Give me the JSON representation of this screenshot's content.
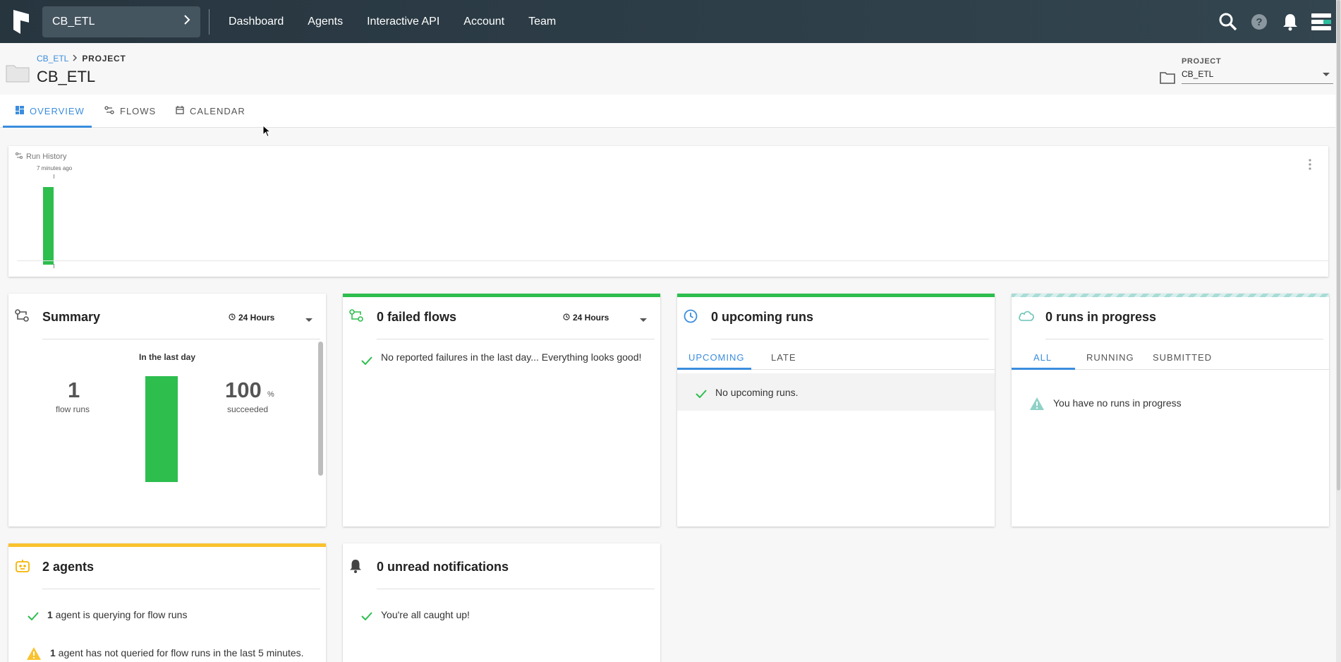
{
  "topbar": {
    "team_name": "CB_ETL",
    "nav": [
      "Dashboard",
      "Agents",
      "Interactive API",
      "Account",
      "Team"
    ],
    "icons": [
      "search-icon",
      "help-icon",
      "bell-icon",
      "menu-icon"
    ]
  },
  "header": {
    "breadcrumb_link": "CB_ETL",
    "breadcrumb_current": "PROJECT",
    "title": "CB_ETL",
    "project_picker_label": "PROJECT",
    "project_picker_value": "CB_ETL"
  },
  "tabs": [
    "OVERVIEW",
    "FLOWS",
    "CALENDAR"
  ],
  "run_history": {
    "title": "Run History",
    "label": "7 minutes ago",
    "runs": [
      {
        "state": "success",
        "color": "#2dbe4e"
      }
    ]
  },
  "summary": {
    "title": "Summary",
    "range": "24 Hours",
    "subtitle": "In the last day",
    "flow_runs": "1",
    "flow_runs_label": "flow runs",
    "succeeded_pct": "100",
    "pct_sign": "%",
    "succeeded_label": "succeeded"
  },
  "failed": {
    "title": "0 failed flows",
    "range": "24 Hours",
    "message": "No reported failures in the last day... Everything looks good!"
  },
  "upcoming": {
    "title": "0 upcoming runs",
    "tabs": [
      "UPCOMING",
      "LATE"
    ],
    "message": "No upcoming runs."
  },
  "in_progress": {
    "title": "0 runs in progress",
    "tabs": [
      "ALL",
      "RUNNING",
      "SUBMITTED"
    ],
    "message": "You have no runs in progress"
  },
  "agents": {
    "title": "2 agents",
    "line1_count": "1",
    "line1_text": " agent is querying for flow runs",
    "line2_count": "1",
    "line2_text": " agent has not queried for flow runs in the last 5 minutes."
  },
  "notifications": {
    "title": "0 unread notifications",
    "message": "You're all caught up!"
  },
  "colors": {
    "accent": "#3b8dde",
    "success": "#2dbe4e",
    "warning": "#f9c22e",
    "topbar": "#2a3944"
  }
}
